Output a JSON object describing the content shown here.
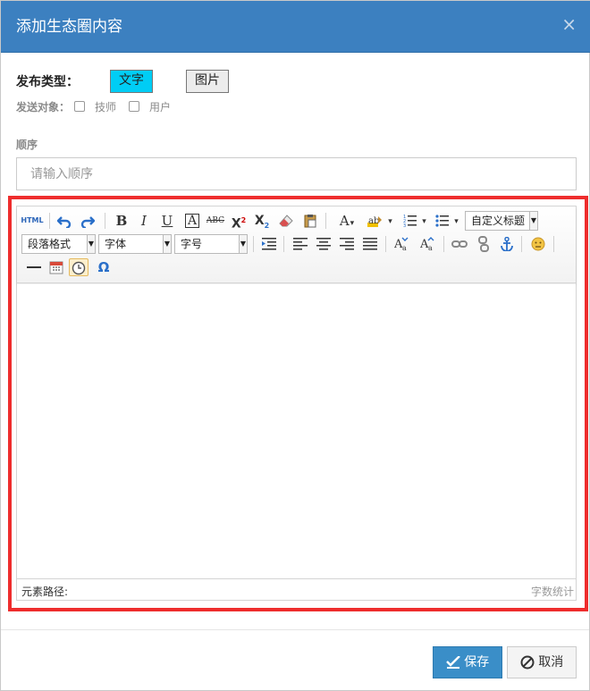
{
  "modal": {
    "title": "添加生态圈内容",
    "close_glyph": "×"
  },
  "publish_type": {
    "label": "发布类型：",
    "options": [
      "文字",
      "图片"
    ],
    "selected": "文字"
  },
  "send_target": {
    "label": "发送对象：",
    "options": [
      "技师",
      "用户"
    ]
  },
  "order": {
    "label": "顺序",
    "placeholder": "请输入顺序",
    "value": ""
  },
  "editor": {
    "toolbar": {
      "html_label": "HTML",
      "bold": "B",
      "italic": "I",
      "underline": "U",
      "fontborder": "A",
      "strike": "ABC",
      "superscript": "X",
      "superscript_mark": "2",
      "subscript": "X",
      "subscript_mark": "2",
      "forecolor": "A",
      "custom_title": "自定义标题",
      "paragraph": "段落格式",
      "font_family": "字体",
      "font_size": "字号",
      "special_char": "Ω",
      "icons": [
        "html-icon",
        "undo-icon",
        "redo-icon",
        "bold-icon",
        "italic-icon",
        "underline-icon",
        "fontborder-icon",
        "strikethrough-icon",
        "superscript-icon",
        "subscript-icon",
        "eraser-icon",
        "paste-plain-icon",
        "forecolor-icon",
        "backcolor-icon",
        "ordered-list-icon",
        "unordered-list-icon",
        "indent-icon",
        "align-left-icon",
        "align-center-icon",
        "align-right-icon",
        "justify-icon",
        "uppercase-icon",
        "lowercase-icon",
        "link-icon",
        "unlink-icon",
        "anchor-icon",
        "emotion-icon",
        "horizontal-rule-icon",
        "date-icon",
        "time-icon",
        "special-char-icon"
      ]
    },
    "status": {
      "path_label": "元素路径:",
      "word_count": "字数统计"
    }
  },
  "footer": {
    "save": "保存",
    "cancel": "取消"
  },
  "colors": {
    "header": "#3c80c0",
    "selected_type": "#00cdf5",
    "highlight_frame": "#ee2d2d",
    "save_button": "#3a8ec8"
  }
}
